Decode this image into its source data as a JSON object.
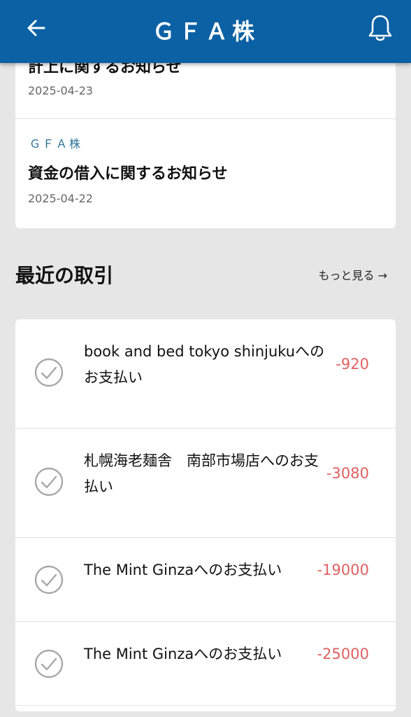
{
  "header": {
    "title": "ＧＦＡ株",
    "back_icon": "arrow-left-icon",
    "bell_icon": "bell-icon",
    "bg_color": "#0b61a4"
  },
  "news": [
    {
      "title": "計上に関するお知らせ",
      "date": "2025-04-23"
    },
    {
      "source": "ＧＦＡ株",
      "title": "資金の借入に関するお知らせ",
      "date": "2025-04-22"
    }
  ],
  "transactions_section": {
    "title": "最近の取引",
    "more_label": "もっと見る →"
  },
  "transactions": [
    {
      "description": "book and bed tokyo shinjukuへのお支払い",
      "amount": "-920",
      "status_icon": "check-circle-icon"
    },
    {
      "description": "札幌海老麺舎　南部市場店へのお支払い",
      "amount": "-3080",
      "status_icon": "check-circle-icon"
    },
    {
      "description": "The Mint Ginzaへのお支払い",
      "amount": "-19000",
      "status_icon": "check-circle-icon"
    },
    {
      "description": "The Mint Ginzaへのお支払い",
      "amount": "-25000",
      "status_icon": "check-circle-icon"
    }
  ],
  "colors": {
    "amount_negative": "#e06060",
    "source_text": "#2a6f97"
  }
}
